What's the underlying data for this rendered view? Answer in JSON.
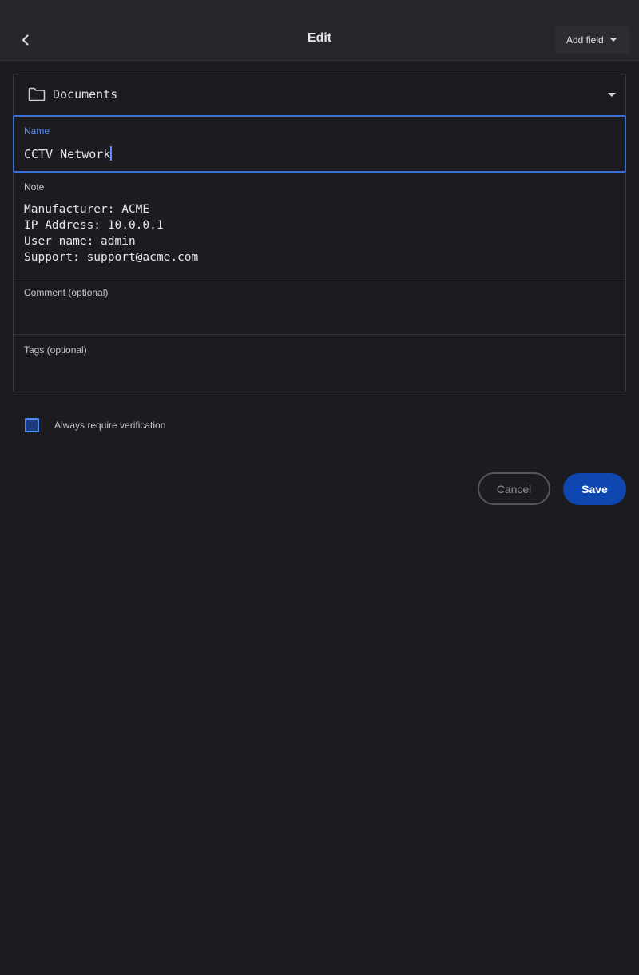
{
  "header": {
    "title": "Edit",
    "add_field_label": "Add field"
  },
  "form": {
    "folder": "Documents",
    "name": {
      "label": "Name",
      "value": "CCTV Network"
    },
    "note": {
      "label": "Note",
      "lines": [
        "Manufacturer: ACME",
        "IP Address: 10.0.0.1",
        "User name: admin",
        "Support: support@acme.com"
      ]
    },
    "comment": {
      "label": "Comment (optional)",
      "value": ""
    },
    "tags": {
      "label": "Tags (optional)",
      "value": ""
    }
  },
  "verification": {
    "label": "Always require verification",
    "checked": false
  },
  "actions": {
    "cancel_label": "Cancel",
    "save_label": "Save"
  },
  "icons": {
    "back": "chevron-left-icon",
    "folder": "folder-icon",
    "dropdown": "caret-down-icon"
  },
  "colors": {
    "accent": "#3a6fd8",
    "save": "#0e47b0",
    "background": "#1c1c20"
  }
}
